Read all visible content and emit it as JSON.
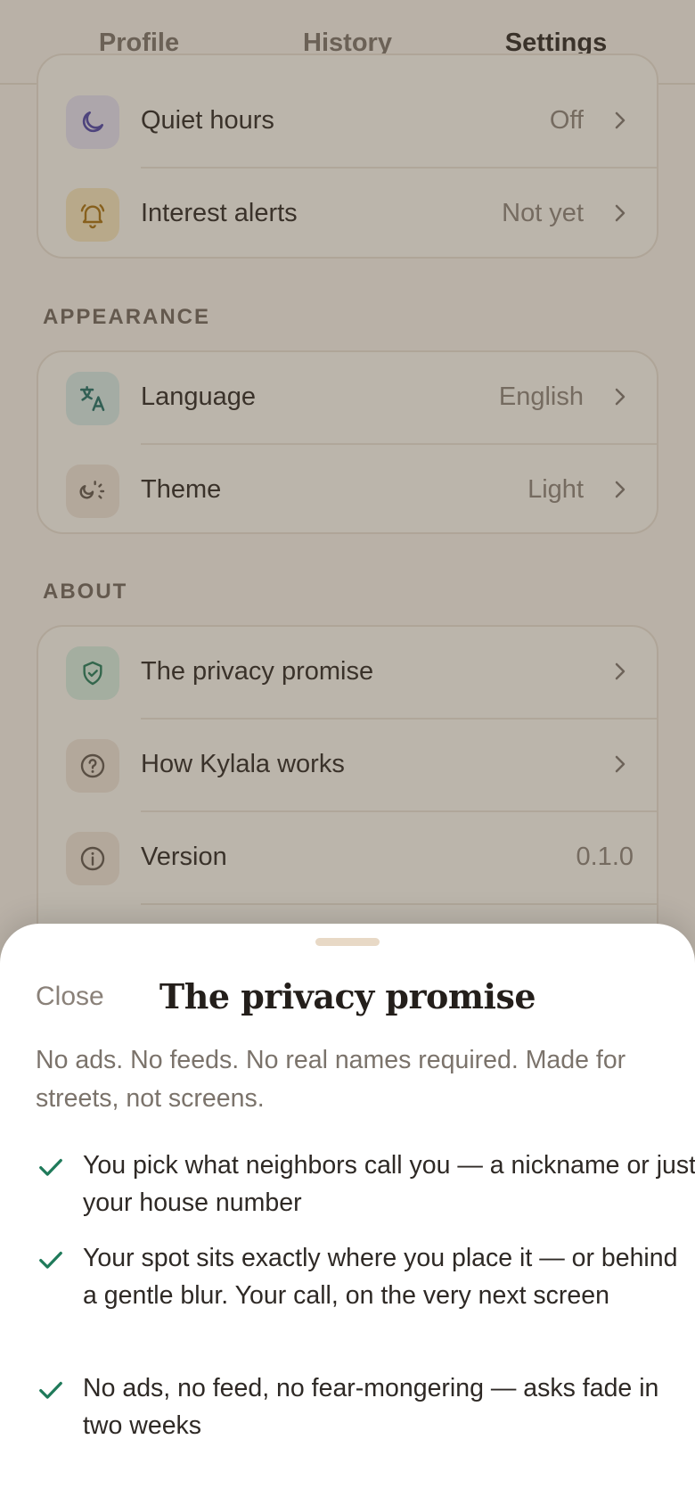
{
  "tabs": [
    {
      "label": "Profile",
      "active": false
    },
    {
      "label": "History",
      "active": false
    },
    {
      "label": "Settings",
      "active": true
    }
  ],
  "notifications_rows": [
    {
      "icon": "moon-icon",
      "label": "Quiet hours",
      "value": "Off"
    },
    {
      "icon": "bell-icon",
      "label": "Interest alerts",
      "value": "Not yet"
    }
  ],
  "appearance": {
    "title": "APPEARANCE",
    "rows": [
      {
        "icon": "translate-icon",
        "label": "Language",
        "value": "English"
      },
      {
        "icon": "theme-icon",
        "label": "Theme",
        "value": "Light"
      }
    ]
  },
  "about": {
    "title": "ABOUT",
    "rows": [
      {
        "icon": "shield-check-icon",
        "label": "The privacy promise",
        "value": ""
      },
      {
        "icon": "question-circle-icon",
        "label": "How Kylala works",
        "value": ""
      },
      {
        "icon": "info-circle-icon",
        "label": "Version",
        "value": "0.1.0"
      }
    ]
  },
  "sheet": {
    "close_label": "Close",
    "title": "The privacy promise",
    "subtitle": "No ads. No feeds. No real names required. Made for streets, not screens.",
    "items": [
      "You pick what neighbors call you — a nickname or just your house number",
      "Your spot sits exactly where you place it — or behind a gentle blur. Your call, on the very next screen",
      "No ads, no feed, no fear-mongering — asks fade in two weeks"
    ]
  },
  "colors": {
    "accent": "#d95a2b",
    "check": "#1f7a5a",
    "background": "#f7f3ec"
  }
}
